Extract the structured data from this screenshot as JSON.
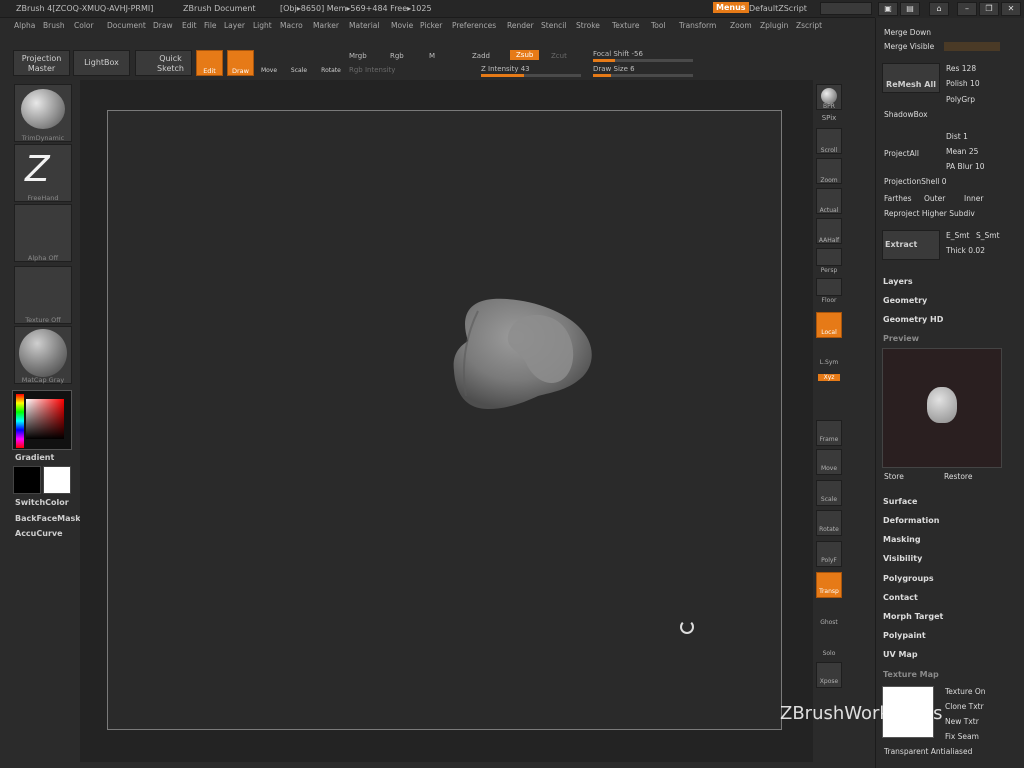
{
  "title": {
    "app": "ZBrush 4[ZCOQ-XMUQ-AVHJ-PRMI]",
    "doc": "ZBrush Document",
    "stats": "[Obj▸8650] Mem▸569+484 Free▸1025",
    "menus_btn": "Menus",
    "script": "DefaultZScript"
  },
  "menu": [
    "Alpha",
    "Brush",
    "Color",
    "Document",
    "Draw",
    "Edit",
    "File",
    "Layer",
    "Light",
    "Macro",
    "Marker",
    "Material",
    "Movie",
    "Picker",
    "Preferences",
    "Render",
    "Stencil",
    "Stroke",
    "Texture",
    "Tool",
    "Transform",
    "Zoom",
    "Zplugin",
    "Zscript"
  ],
  "toolbar": {
    "projection_master": "Projection Master",
    "lightbox": "LightBox",
    "quick_sketch": "Quick Sketch",
    "edit": "Edit",
    "draw": "Draw",
    "move": "Move",
    "scale": "Scale",
    "rotate": "Rotate",
    "mrgb": "Mrgb",
    "rgb": "Rgb",
    "m": "M",
    "zadd": "Zadd",
    "zsub": "Zsub",
    "zcut": "Zcut",
    "rgb_intensity": "Rgb Intensity",
    "z_intensity": "Z Intensity 43",
    "focal_shift": "Focal Shift -56",
    "draw_size": "Draw Size 6"
  },
  "toolbar_values": {
    "z_intensity": 43,
    "focal_shift": -56,
    "draw_size": 6
  },
  "left": {
    "brush": "TrimDynamic",
    "stroke": "FreeHand",
    "alpha": "Alpha Off",
    "texture": "Texture Off",
    "material": "MatCap Gray",
    "gradient": "Gradient",
    "switchcolor": "SwitchColor",
    "backface": "BackFaceMask",
    "accucurve": "AccuCurve"
  },
  "right_shelf": [
    "BPR",
    "SPix",
    "Scroll",
    "Zoom",
    "Actual",
    "AAHalf",
    "Persp",
    "Floor",
    "Local",
    "L.Sym",
    "Xyz",
    "Frame",
    "Move",
    "Scale",
    "Rotate",
    "PolyF",
    "Transp",
    "Ghost",
    "Solo",
    "Xpose"
  ],
  "tray": {
    "merge_down": "Merge Down",
    "merge_visible": "Merge Visible",
    "remesh_all": "ReMesh All",
    "res": "Res 128",
    "polish": "Polish 10",
    "polygrp": "PolyGrp",
    "shadowbox": "ShadowBox",
    "project_all": "ProjectAll",
    "dist": "Dist 1",
    "mean": "Mean 25",
    "pa_blur": "PA Blur 10",
    "projection_shell": "ProjectionShell 0",
    "farthest": "Farthes",
    "outer": "Outer",
    "inner": "Inner",
    "reproject": "Reproject Higher Subdiv",
    "extract": "Extract",
    "e_smt": "E_Smt",
    "s_smt": "S_Smt",
    "thick": "Thick 0.02",
    "layers": "Layers",
    "geometry": "Geometry",
    "geometry_hd": "Geometry HD",
    "preview": "Preview",
    "store": "Store",
    "restore": "Restore",
    "sections": [
      "Surface",
      "Deformation",
      "Masking",
      "Visibility",
      "Polygroups",
      "Contact",
      "Morph Target",
      "Polypaint",
      "UV Map"
    ],
    "texture_map": "Texture Map",
    "texture_on": "Texture On",
    "clone_txtr": "Clone Txtr",
    "new_txtr": "New Txtr",
    "fix_seam": "Fix Seam",
    "transparent": "Transparent  Antialiased"
  },
  "watermark": "ZBrushWorkshops",
  "colors": {
    "accent": "#e67a17",
    "bg": "#2b2b2b",
    "canvas": "#2a2a2a"
  }
}
